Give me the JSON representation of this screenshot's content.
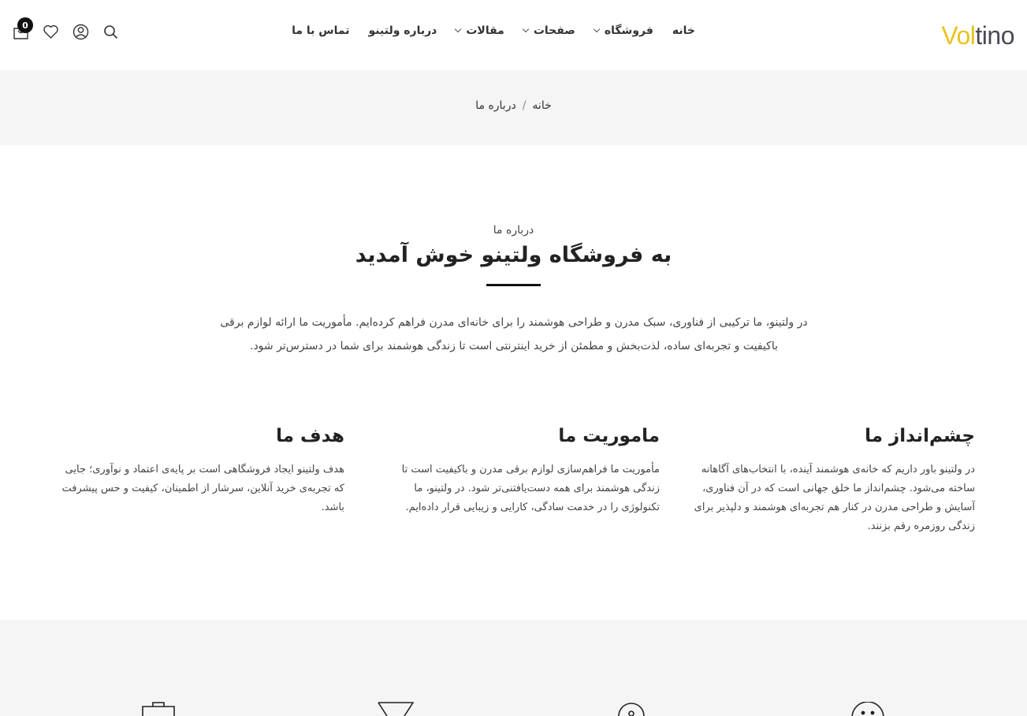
{
  "header": {
    "logo_part1": "Vol",
    "logo_part2": "tino",
    "nav": [
      {
        "label": "خانه",
        "has_dropdown": false
      },
      {
        "label": "فروشگاه",
        "has_dropdown": true
      },
      {
        "label": "صفحات",
        "has_dropdown": true
      },
      {
        "label": "مقالات",
        "has_dropdown": true
      },
      {
        "label": "درباره ولتینو",
        "has_dropdown": false
      },
      {
        "label": "تماس با ما",
        "has_dropdown": false
      }
    ],
    "cart_count": "0",
    "icons": [
      "search-icon",
      "user-icon",
      "heart-icon",
      "cart-icon"
    ]
  },
  "breadcrumb": {
    "home": "خانه",
    "separator": "/",
    "current": "درباره ما"
  },
  "intro": {
    "kicker": "درباره ما",
    "title": "به فروشگاه ولتینو خوش آمدید",
    "text_line1": "در ولتینو، ما ترکیبی از فناوری، سبک مدرن و طراحی هوشمند را برای خانه‌ای مدرن فراهم کرده‌ایم. مأموریت ما ارائه لوازم برقی",
    "text_line2": "باکیفیت و تجربه‌ای ساده، لذت‌بخش و مطمئن از خرید اینترنتی است تا زندگی هوشمند برای شما در دسترس‌تر شود."
  },
  "columns": [
    {
      "title": "چشم‌انداز ما",
      "text": "در ولتینو باور داریم که خانه‌ی هوشمند آینده، با انتخاب‌های آگاهانه ساخته می‌شود. چشم‌انداز ما خلق جهانی است که در آن فناوری، آسایش و طراحی مدرن در کنار هم تجربه‌ای هوشمند و دلپذیر برای زندگی روزمره رقم بزنند."
    },
    {
      "title": "ماموریت ما",
      "text": "مأموریت ما فراهم‌سازی لوازم برقی مدرن و باکیفیت است تا زندگی هوشمند برای همه دست‌یافتنی‌تر شود. در ولتینو، ما تکنولوژی را در خدمت سادگی، کارایی و زیبایی قرار داده‌ایم."
    },
    {
      "title": "هدف ما",
      "text": "هدف ولتینو ایجاد فروشگاهی است بر پایه‌ی اعتماد و نوآوری؛ جایی که تجربه‌ی خرید آنلاین، سرشار از اطمینان، کیفیت و حس پیشرفت باشد."
    }
  ],
  "colors": {
    "logo_accent": "#e8c31b",
    "logo_dark": "#4a4a55",
    "band_bg": "#f5f5f5",
    "text": "#333333"
  }
}
